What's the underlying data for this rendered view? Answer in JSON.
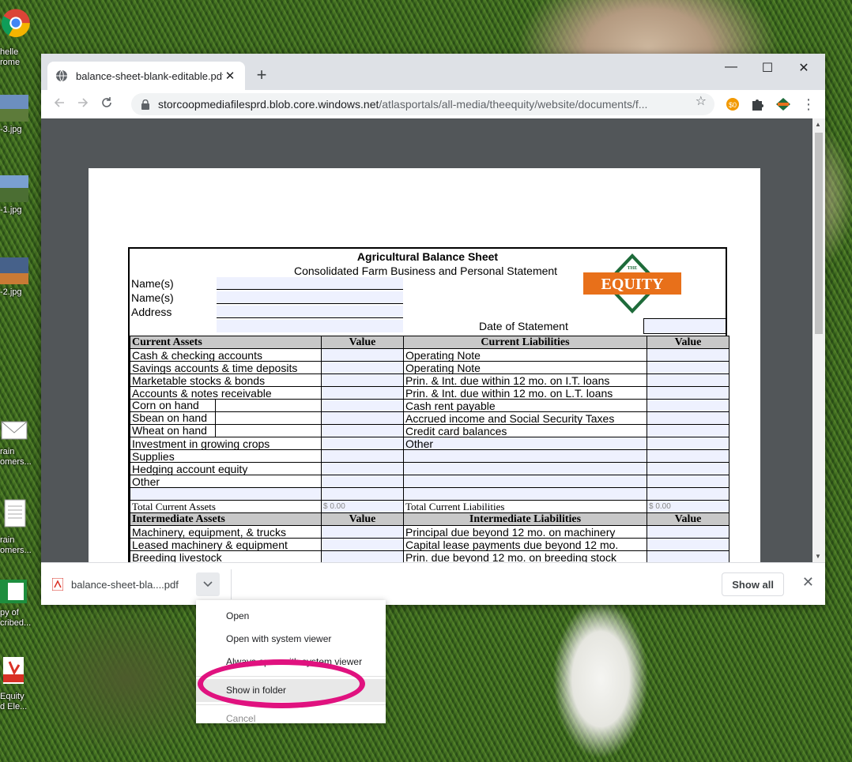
{
  "desktop": {
    "icons": [
      {
        "label": "helle\nrome"
      },
      {
        "label": "-3.jpg"
      },
      {
        "label": "-1.jpg"
      },
      {
        "label": "-2.jpg"
      },
      {
        "label": "rain\nomers..."
      },
      {
        "label": "rain\nomers..."
      },
      {
        "label": "py of\ncribed..."
      },
      {
        "label": "Equity\nd Ele..."
      }
    ]
  },
  "browser": {
    "tab_title": "balance-sheet-blank-editable.pdf",
    "url_host": "storcoopmediafilesprd.blob.core.windows.net",
    "url_path": "/atlasportals/all-media/theequity/website/documents/f...",
    "icons": {
      "back": "arrow-left-icon",
      "forward": "arrow-right-icon",
      "reload": "reload-icon",
      "lock": "lock-icon",
      "star": "star-icon"
    }
  },
  "sheet": {
    "title": "Agricultural Balance Sheet",
    "subtitle": "Consolidated Farm Business and Personal Statement",
    "labels": {
      "name1": "Name(s)",
      "name2": "Name(s)",
      "address": "Address",
      "date": "Date of Statement"
    },
    "logo": {
      "small": "THE",
      "big": "EQUITY",
      "color_orange": "#e8701a",
      "color_green": "#1e6b3a"
    },
    "current_assets_hdr": "Current Assets",
    "current_liab_hdr": "Current Liabilities",
    "value_hdr": "Value",
    "assets": [
      "Cash & checking accounts",
      "Savings accounts & time deposits",
      "Marketable stocks & bonds",
      "Accounts & notes receivable",
      "Corn on hand",
      "Sbean on hand",
      "Wheat on hand",
      "Investment in growing crops",
      "Supplies",
      "Hedging account equity",
      "Other",
      ""
    ],
    "liabilities": [
      "Operating Note",
      "Operating Note",
      "Prin. & Int. due within 12 mo. on I.T. loans",
      "Prin. & Int. due within 12 mo. on L.T. loans",
      "Cash rent payable",
      "Accrued income and Social Security Taxes",
      "Credit card balances",
      "Other",
      "",
      "",
      "",
      ""
    ],
    "total_assets": "Total Current Assets",
    "total_liab": "Total Current Liabilities",
    "zero": "$ 0.00",
    "int_assets_hdr": "Intermediate Assets",
    "int_liab_hdr": "Intermediate Liabilities",
    "int_assets": [
      "Machinery, equipment, & trucks",
      "Leased machinery & equipment",
      "Breeding livestock"
    ],
    "int_liab": [
      "Principal due beyond 12 mo. on machinery",
      "Capital lease payments due beyond 12 mo.",
      "Prin. due beyond 12 mo. on breeding stock"
    ]
  },
  "download": {
    "file": "balance-sheet-bla....pdf",
    "show_all": "Show all"
  },
  "menu": {
    "open": "Open",
    "open_system": "Open with system viewer",
    "always_open": "Always open with system viewer",
    "show_folder": "Show in folder",
    "cancel": "Cancel"
  },
  "colors": {
    "highlight": "#e0127f"
  }
}
